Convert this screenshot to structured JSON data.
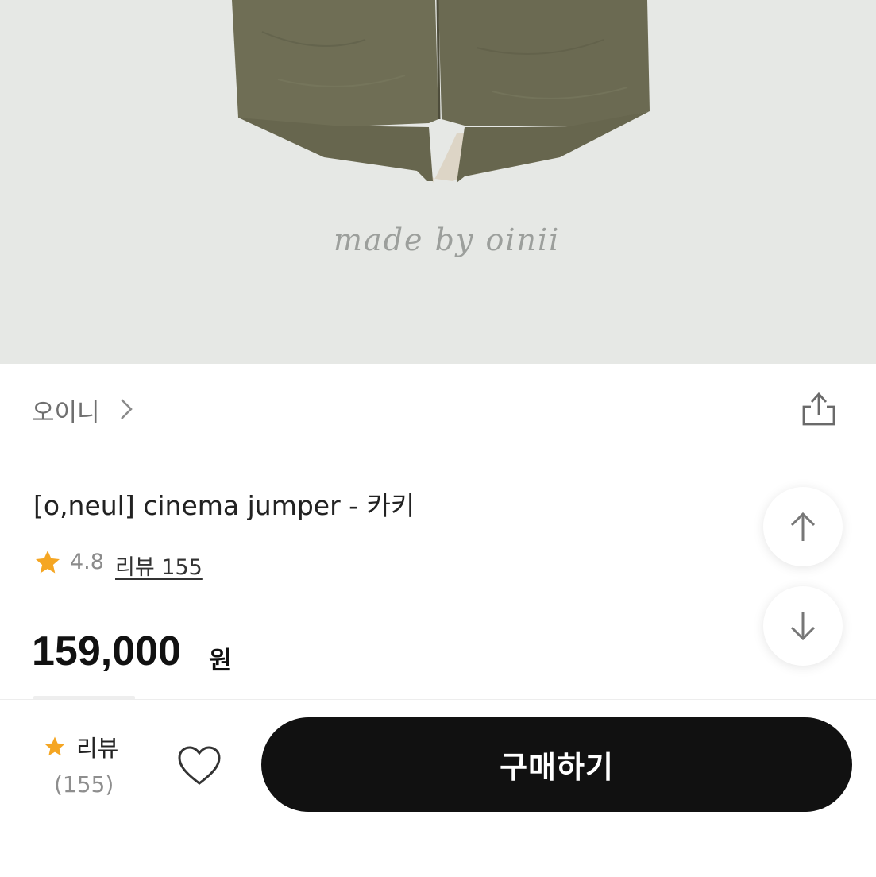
{
  "hero": {
    "image_caption": "made by oinii"
  },
  "brand": {
    "name": "오이니",
    "chevron_icon": "chevron-right-icon",
    "share_icon": "share-icon"
  },
  "product": {
    "title": "[o,neul] cinema jumper - 카키",
    "rating": "4.8",
    "review_link": "리뷰 155",
    "price": "159,000",
    "currency": "원"
  },
  "scroll": {
    "up_icon": "arrow-up-icon",
    "down_icon": "arrow-down-icon"
  },
  "bottom_bar": {
    "review_label": "리뷰",
    "review_count": "(155)",
    "wishlist_icon": "heart-icon",
    "buy_label": "구매하기"
  },
  "colors": {
    "star": "#f5a623",
    "button": "#111111",
    "hero_background": "#e6e8e5",
    "garment": "#6f6e55"
  }
}
